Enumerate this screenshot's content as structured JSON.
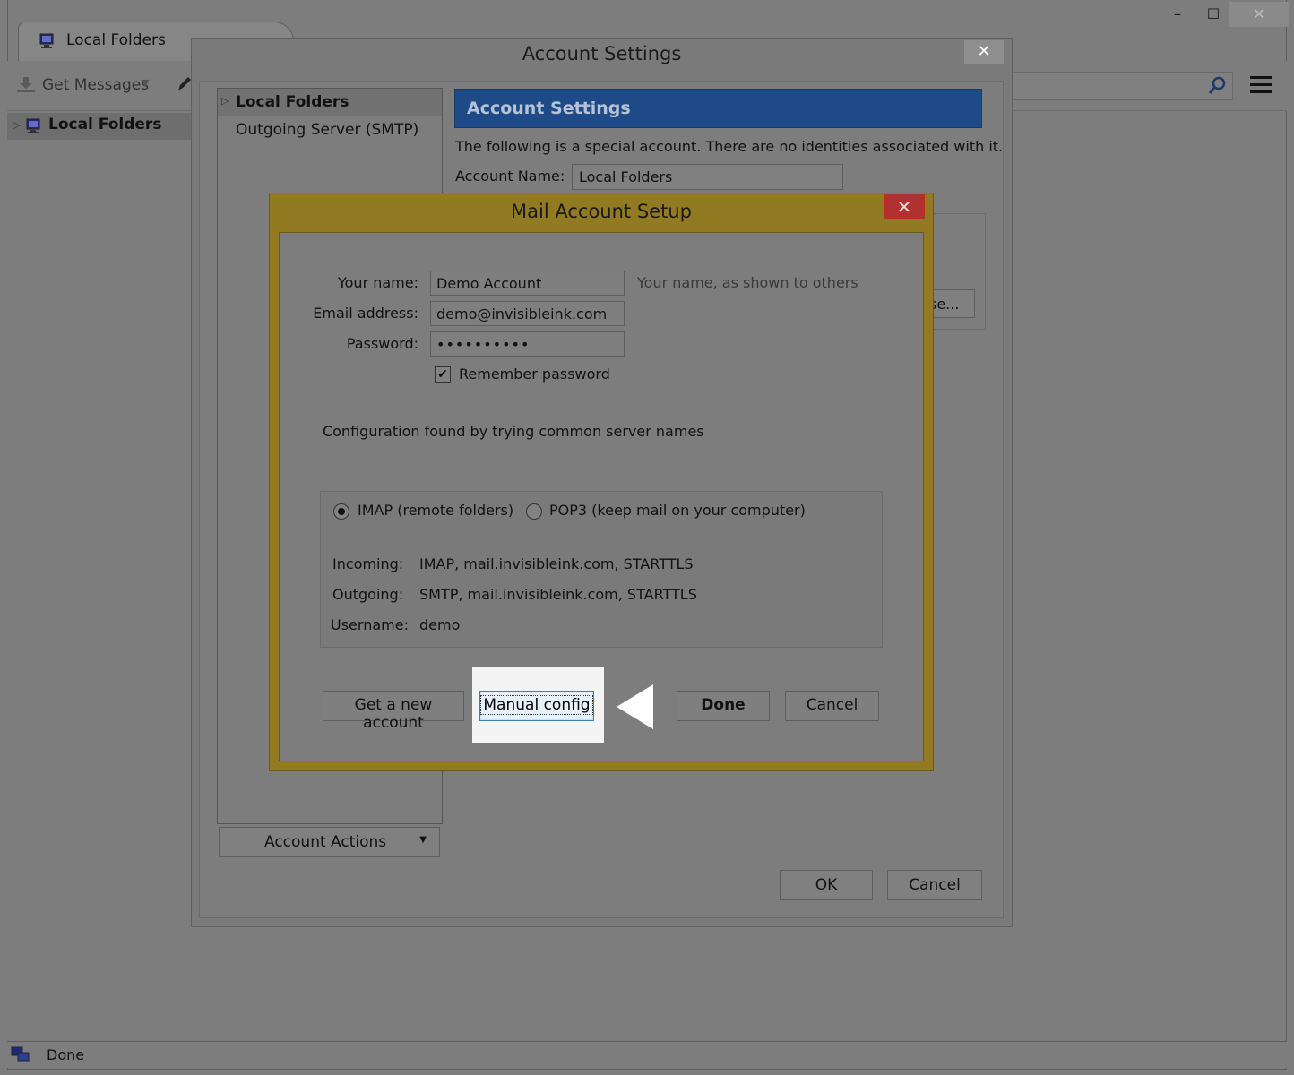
{
  "window": {
    "tab_title": "Local Folders",
    "controls": {
      "minimize": "–",
      "maximize": "☐",
      "close": "✕"
    }
  },
  "toolbar": {
    "get_messages_label": "Get Messages",
    "search_icon": "search-icon",
    "menu_icon": "hamburger-menu-icon"
  },
  "folder_pane": {
    "items": [
      {
        "label": "Local Folders",
        "icon": "local-folders-icon"
      }
    ]
  },
  "statusbar": {
    "text": "Done"
  },
  "account_settings": {
    "title": "Account Settings",
    "close_label": "✕",
    "tree": {
      "root_label": "Local Folders",
      "child_label": "Outgoing Server (SMTP)"
    },
    "banner": "Account Settings",
    "description": "The following is a special account. There are no identities associated with it.",
    "account_name_label": "Account Name:",
    "account_name_value": "Local Folders",
    "browse_partial_label": "se...",
    "account_actions_label": "Account Actions",
    "ok_label": "OK",
    "cancel_label": "Cancel"
  },
  "mail_setup": {
    "title": "Mail Account Setup",
    "close_label": "✕",
    "fields": {
      "name_label": "Your name:",
      "name_value": "Demo Account",
      "name_hint": "Your name, as shown to others",
      "email_label": "Email address:",
      "email_value": "demo@invisibleink.com",
      "password_label": "Password:",
      "password_value": "••••••••••",
      "remember_label": "Remember password",
      "remember_checked": true
    },
    "config_message": "Configuration found by trying common server names",
    "protocol": {
      "imap_label": "IMAP (remote folders)",
      "pop3_label": "POP3 (keep mail on your computer)",
      "selected": "IMAP"
    },
    "servers": {
      "incoming_label": "Incoming:",
      "incoming_value": "IMAP, mail.invisibleink.com, STARTTLS",
      "outgoing_label": "Outgoing:",
      "outgoing_value": "SMTP, mail.invisibleink.com, STARTTLS",
      "username_label": "Username:",
      "username_value": "demo"
    },
    "buttons": {
      "get_new_account": "Get a new account",
      "manual_config": "Manual config",
      "done": "Done",
      "cancel": "Cancel"
    }
  },
  "colors": {
    "overlay": "#7d7d7d",
    "dialog_frame": "#927a23",
    "banner": "#1e4a87",
    "highlight": "#f4f4f4",
    "focus_button": "#e7f1fb",
    "pointer": "#ffffff"
  }
}
